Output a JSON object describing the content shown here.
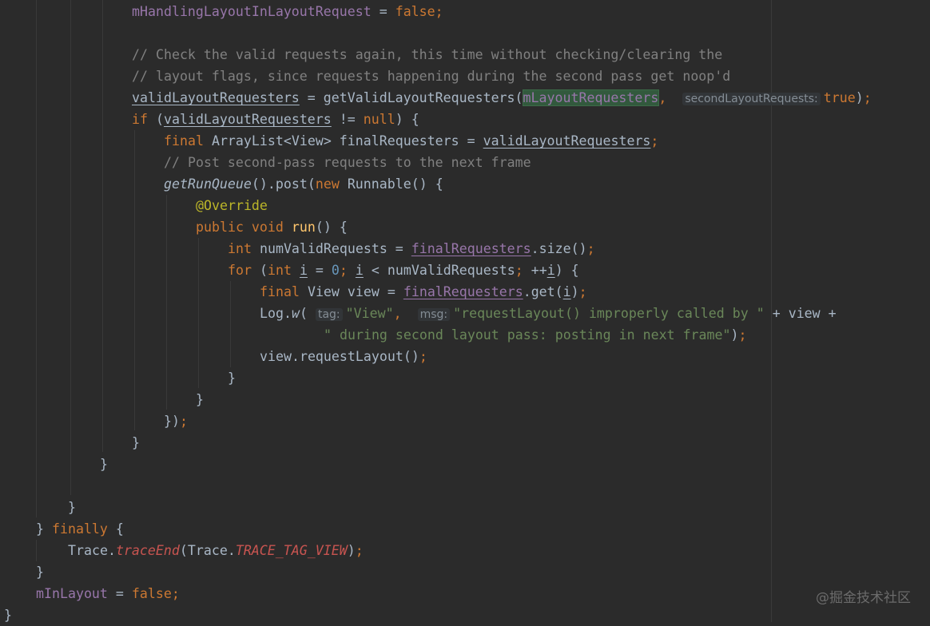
{
  "editor": {
    "language": "java",
    "theme": "darcula",
    "lines": [
      {
        "t": "mHandlingLayoutInLayoutRequest = false;"
      },
      {
        "t": ""
      },
      {
        "t": "// Check the valid requests again, this time without checking/clearing the"
      },
      {
        "t": "// layout flags, since requests happening during the second pass get noop'd"
      },
      {
        "t": "validLayoutRequesters = getValidLayoutRequesters(mLayoutRequesters, secondLayoutRequests: true);"
      },
      {
        "t": "if (validLayoutRequesters != null) {"
      },
      {
        "t": "final ArrayList<View> finalRequesters = validLayoutRequesters;"
      },
      {
        "t": "// Post second-pass requests to the next frame"
      },
      {
        "t": "getRunQueue().post(new Runnable() {"
      },
      {
        "t": "@Override"
      },
      {
        "t": "public void run() {"
      },
      {
        "t": "int numValidRequests = finalRequesters.size();"
      },
      {
        "t": "for (int i = 0; i < numValidRequests; ++i) {"
      },
      {
        "t": "final View view = finalRequesters.get(i);"
      },
      {
        "t": "Log.w( tag: \"View\",  msg: \"requestLayout() improperly called by \" + view +"
      },
      {
        "t": "\" during second layout pass: posting in next frame\");"
      },
      {
        "t": "view.requestLayout();"
      },
      {
        "t": "}"
      },
      {
        "t": "}"
      },
      {
        "t": "});"
      },
      {
        "t": "}"
      },
      {
        "t": "}"
      },
      {
        "t": ""
      },
      {
        "t": "}"
      },
      {
        "t": "} finally {"
      },
      {
        "t": "Trace.traceEnd(Trace.TRACE_TAG_VIEW);"
      },
      {
        "t": "}"
      },
      {
        "t": "mInLayout = false;"
      },
      {
        "t": "}"
      }
    ]
  },
  "watermark": "@掘金技术社区"
}
